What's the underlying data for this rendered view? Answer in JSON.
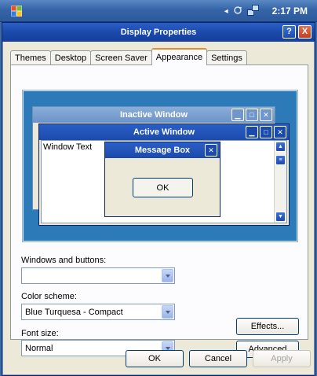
{
  "taskbar": {
    "clock": "2:17 PM",
    "tray_arrow": "◂",
    "tray_icons": [
      "arrow-left-icon",
      "sync-icon",
      "network-icon"
    ]
  },
  "dialog": {
    "title": "Display Properties",
    "help_btn": "?",
    "close_btn": "X",
    "tabs": [
      "Themes",
      "Desktop",
      "Screen Saver",
      "Appearance",
      "Settings"
    ],
    "active_tab": "Appearance"
  },
  "preview": {
    "inactive_title": "Inactive Window",
    "active_title": "Active Window",
    "window_text": "Window Text",
    "message_title": "Message Box",
    "message_ok": "OK"
  },
  "form": {
    "windows_buttons_label": "Windows and buttons:",
    "windows_buttons_value": "",
    "color_scheme_label": "Color scheme:",
    "color_scheme_value": "Blue Turquesa - Compact",
    "font_size_label": "Font size:",
    "font_size_value": "Normal",
    "effects_btn": "Effects...",
    "advanced_btn": "Advanced"
  },
  "footer": {
    "ok": "OK",
    "cancel": "Cancel",
    "apply": "Apply"
  },
  "colors": {
    "titlebar": "#1b4aab",
    "preview_desktop": "#2c7ab8",
    "active_tab_highlight": "#e68b2c"
  }
}
